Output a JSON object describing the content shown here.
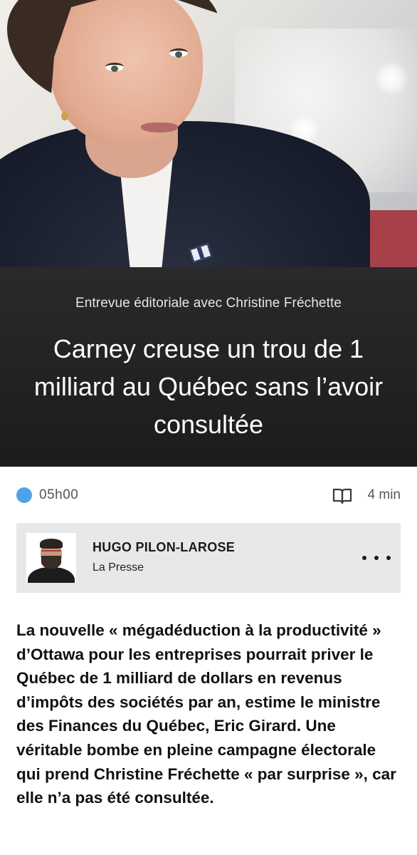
{
  "hero": {
    "kicker": "Entrevue éditoriale avec Christine Fréchette",
    "title": "Carney creuse un trou de 1 milliard au Québec sans l’avoir consultée"
  },
  "meta": {
    "time": "05h00",
    "time_indicator_color": "#4ea3e8",
    "read_icon": "book-icon",
    "read_time": "4 min"
  },
  "author": {
    "name": "HUGO PILON-LAROSE",
    "outlet": "La Presse",
    "more_icon": "more-options-icon"
  },
  "article": {
    "lede": "La nouvelle « mégadéduction à la productivité » d’Ottawa pour les entreprises pourrait priver le Québec de 1 milliard de dollars en revenus d’impôts des sociétés par an, estime le ministre des Finances du Québec, Eric Girard. Une véritable bombe en pleine campagne électorale qui prend Christine Fréchette « par surprise », car elle n’a pas été consultée."
  }
}
